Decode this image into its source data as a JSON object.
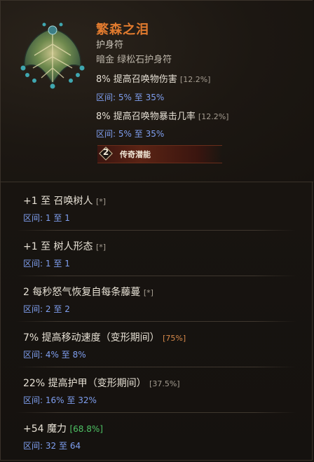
{
  "item": {
    "name": "繁森之泪",
    "type": "护身符",
    "subtype": "暗金 绿松石护身符",
    "icon": "leaf-amulet-icon"
  },
  "header_affixes": [
    {
      "text": "8% 提高召唤物伤害",
      "bracket": "[12.2%]",
      "range_label": "区间",
      "range_min": "5%",
      "range_sep": "至",
      "range_max": "35%"
    },
    {
      "text": "8% 提高召唤物暴击几率",
      "bracket": "[12.2%]",
      "range_label": "区间",
      "range_min": "5%",
      "range_sep": "至",
      "range_max": "35%"
    }
  ],
  "potential": {
    "number": "2",
    "label": "传奇潜能"
  },
  "affixes": [
    {
      "text": "+1 至 召唤树人",
      "bracket": "[*]",
      "range_label": "区间",
      "range_min": "1",
      "range_sep": "至",
      "range_max": "1"
    },
    {
      "text": "+1 至 树人形态",
      "bracket": "[*]",
      "range_label": "区间",
      "range_min": "1",
      "range_sep": "至",
      "range_max": "1"
    },
    {
      "text": "2 每秒怒气恢复自每条藤蔓",
      "bracket": "[*]",
      "range_label": "区间",
      "range_min": "2",
      "range_sep": "至",
      "range_max": "2"
    },
    {
      "text": "7% 提高移动速度（变形期间）",
      "bracket": "[75%]",
      "range_label": "区间",
      "range_min": "4%",
      "range_sep": "至",
      "range_max": "8%"
    },
    {
      "text": "22% 提高护甲（变形期间）",
      "bracket": "[37.5%]",
      "range_label": "区间",
      "range_min": "16%",
      "range_sep": "至",
      "range_max": "32%"
    },
    {
      "text": "+54 魔力",
      "bracket": "[68.8%]",
      "range_label": "区间",
      "range_min": "32",
      "range_sep": "至",
      "range_max": "64"
    }
  ],
  "colors": {
    "item_name": "#e07a2e",
    "range_blue": "#7f9ff0",
    "bracket_orange": "#d88a4a",
    "bracket_green": "#4ec264"
  }
}
